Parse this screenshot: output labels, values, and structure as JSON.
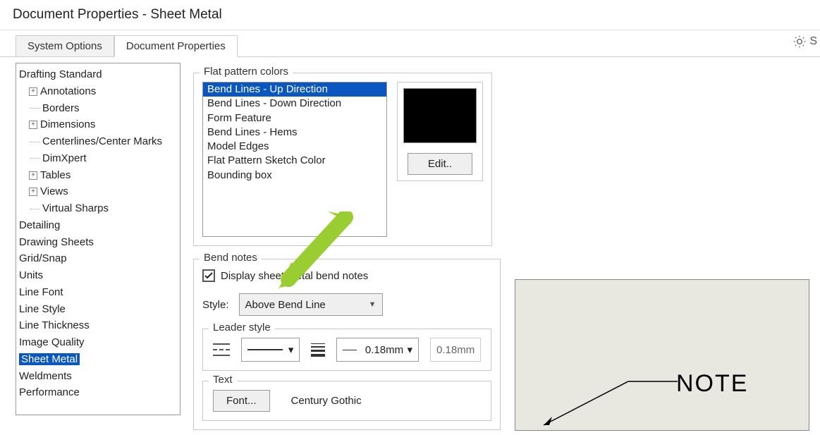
{
  "title": "Document Properties - Sheet Metal",
  "tabs": {
    "system": "System Options",
    "doc": "Document Properties"
  },
  "gear_label": "S",
  "tree": {
    "drafting": "Drafting Standard",
    "annotations": "Annotations",
    "borders": "Borders",
    "dimensions": "Dimensions",
    "centerlines": "Centerlines/Center Marks",
    "dimxpert": "DimXpert",
    "tables": "Tables",
    "views": "Views",
    "virtual_sharps": "Virtual Sharps",
    "detailing": "Detailing",
    "drawing_sheets": "Drawing Sheets",
    "grid_snap": "Grid/Snap",
    "units": "Units",
    "line_font": "Line Font",
    "line_style": "Line Style",
    "line_thickness": "Line Thickness",
    "image_quality": "Image Quality",
    "sheet_metal": "Sheet Metal",
    "weldments": "Weldments",
    "performance": "Performance"
  },
  "flat_pattern": {
    "title": "Flat pattern colors",
    "items": [
      "Bend Lines - Up Direction",
      "Bend Lines - Down Direction",
      "Form Feature",
      "Bend Lines - Hems",
      "Model Edges",
      "Flat Pattern Sketch Color",
      "Bounding box"
    ],
    "swatch_color": "#000000",
    "edit": "Edit.."
  },
  "bend_notes": {
    "title": "Bend notes",
    "checkbox_label": "Display sheet metal bend notes",
    "checked": true,
    "style_label": "Style:",
    "style_value": "Above Bend Line",
    "leader_title": "Leader style",
    "thickness_value": "0.18mm",
    "thickness_readout": "0.18mm",
    "text_title": "Text",
    "font_btn": "Font...",
    "font_name": "Century Gothic"
  },
  "preview": {
    "note": "NOTE"
  }
}
